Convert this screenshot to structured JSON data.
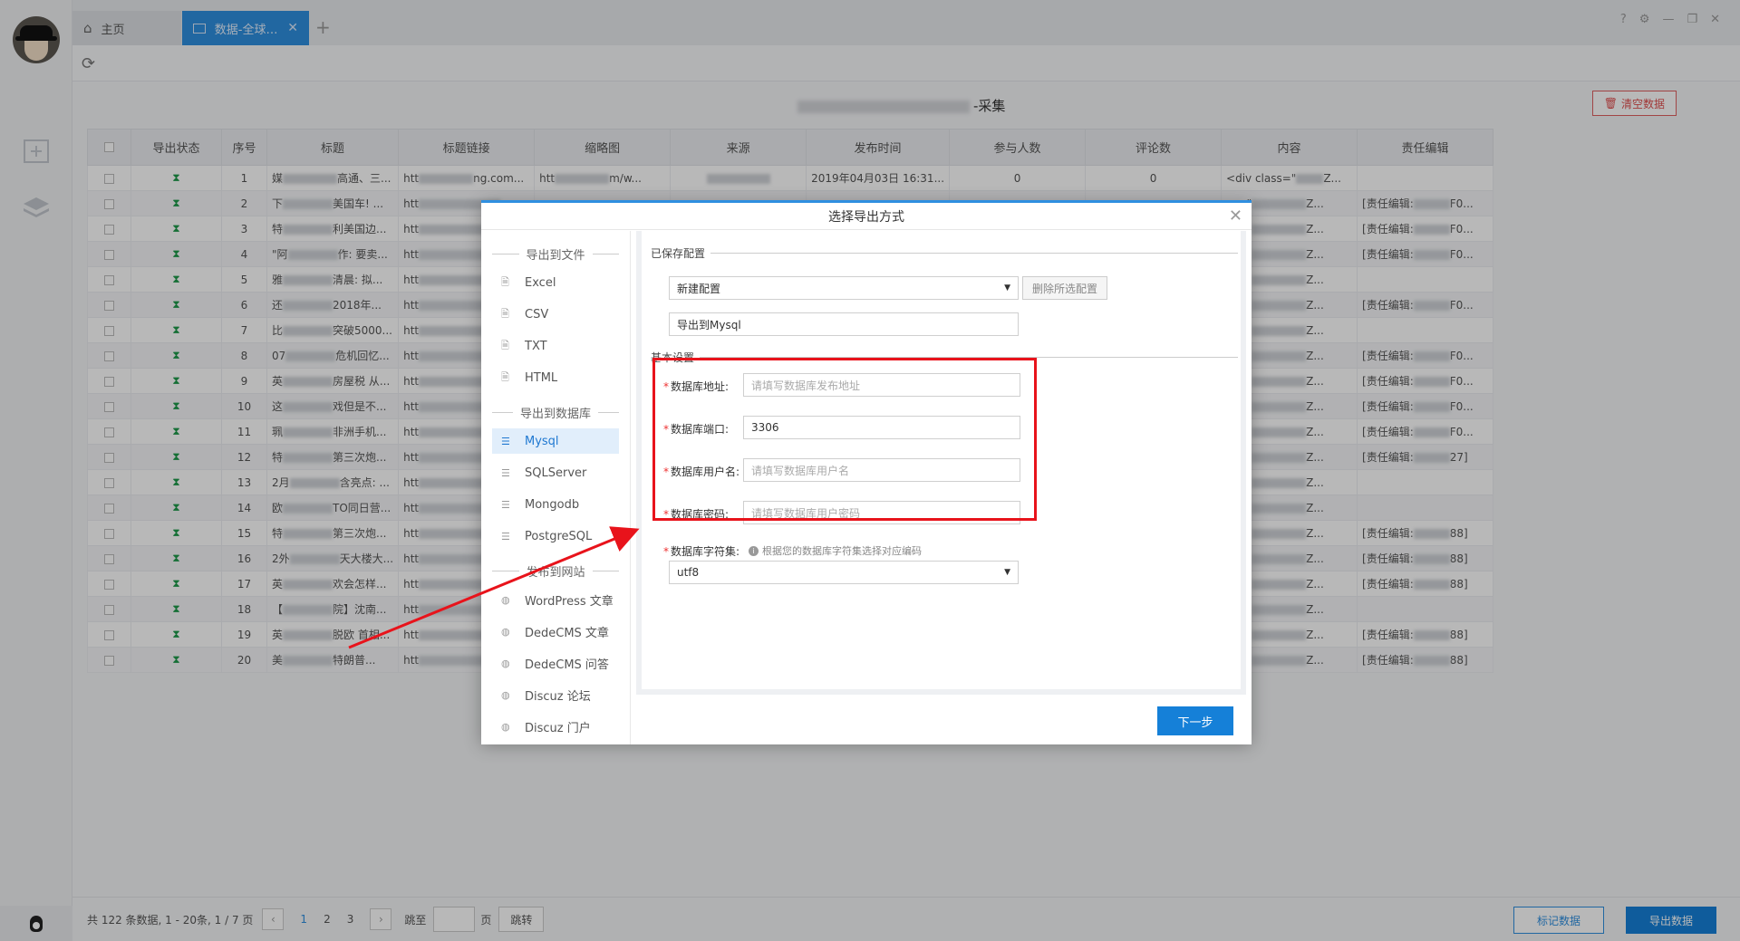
{
  "tabs": {
    "home": "主页",
    "active": "数据-全球财..."
  },
  "page": {
    "title_suffix": "-采集",
    "clear_button": "清空数据"
  },
  "table": {
    "headers": [
      "",
      "导出状态",
      "序号",
      "标题",
      "标题链接",
      "缩略图",
      "来源",
      "发布时间",
      "参与人数",
      "评论数",
      "内容",
      "责任编辑"
    ],
    "row1": {
      "title": "媒",
      "title2": "高通、三...",
      "link": "htt",
      "link2": "ng.com...",
      "thumb": "htt",
      "thumb2": "m/w...",
      "source": "",
      "time": "2019年04月03日 16:31...",
      "participants": "0",
      "comments": "0",
      "content": "<div class=\"",
      "content2": "Z...",
      "editor": ""
    },
    "rows": [
      {
        "n": "2",
        "t": "下",
        "t2": "美国车! ...",
        "e": "[责任编辑:",
        "e2": "F0..."
      },
      {
        "n": "3",
        "t": "特",
        "t2": "利美国边...",
        "e": "[责任编辑:",
        "e2": "F0..."
      },
      {
        "n": "4",
        "t": "\"阿",
        "t2": "作: 要卖...",
        "e": "[责任编辑:",
        "e2": "F0..."
      },
      {
        "n": "5",
        "t": "雅",
        "t2": "清晨: 拟...",
        "e": "",
        "e2": ""
      },
      {
        "n": "6",
        "t": "还",
        "t2": "2018年...",
        "e": "[责任编辑:",
        "e2": "F0..."
      },
      {
        "n": "7",
        "t": "比",
        "t2": "突破5000...",
        "e": "",
        "e2": ""
      },
      {
        "n": "8",
        "t": "07",
        "t2": "危机回忆...",
        "e": "[责任编辑:",
        "e2": "F0..."
      },
      {
        "n": "9",
        "t": "英",
        "t2": "房屋税 从...",
        "e": "[责任编辑:",
        "e2": "F0..."
      },
      {
        "n": "10",
        "t": "这",
        "t2": "戏但是不...",
        "e": "[责任编辑:",
        "e2": "F0..."
      },
      {
        "n": "11",
        "t": "珮",
        "t2": "非洲手机...",
        "e": "[责任编辑:",
        "e2": "F0..."
      },
      {
        "n": "12",
        "t": "特",
        "t2": "第三次炮...",
        "e": "[责任编辑:",
        "e2": "27]"
      },
      {
        "n": "13",
        "t": "2月",
        "t2": "含亮点: ...",
        "e": "",
        "e2": ""
      },
      {
        "n": "14",
        "t": "欧",
        "t2": "TO同日营...",
        "e": "",
        "e2": ""
      },
      {
        "n": "15",
        "t": "特",
        "t2": "第三次炮...",
        "e": "[责任编辑:",
        "e2": "88]"
      },
      {
        "n": "16",
        "t": "2外",
        "t2": "天大楼大...",
        "e": "[责任编辑:",
        "e2": "88]"
      },
      {
        "n": "17",
        "t": "英",
        "t2": "欢会怎样...",
        "e": "[责任编辑:",
        "e2": "88]"
      },
      {
        "n": "18",
        "t": "【",
        "t2": "院】沈南...",
        "e": "",
        "e2": ""
      },
      {
        "n": "19",
        "t": "英",
        "t2": "脱欧 首相...",
        "e": "[责任编辑:",
        "e2": "88]"
      },
      {
        "n": "20",
        "t": "美",
        "t2": "特朗普...",
        "e": "[责任编辑:",
        "e2": "88]"
      }
    ],
    "link_prefix": "htt",
    "content_prefix": "ss=\"",
    "content_suffix": "Z..."
  },
  "pager": {
    "summary": "共 122 条数据, 1 - 20条, 1 / 7 页",
    "p1": "1",
    "p2": "2",
    "p3": "3",
    "goto": "跳至",
    "page_unit": "页",
    "go": "跳转",
    "mark": "标记数据",
    "export": "导出数据"
  },
  "modal": {
    "title": "选择导出方式",
    "group_file": "导出到文件",
    "group_db": "导出到数据库",
    "group_web": "发布到网站",
    "files": [
      "Excel",
      "CSV",
      "TXT",
      "HTML"
    ],
    "dbs": [
      "Mysql",
      "SQLServer",
      "Mongodb",
      "PostgreSQL"
    ],
    "webs": [
      "WordPress 文章",
      "DedeCMS 文章",
      "DedeCMS 问答",
      "Discuz 论坛",
      "Discuz 门户"
    ],
    "saved_section": "已保存配置",
    "saved_select": "新建配置",
    "delete_btn": "删除所选配置",
    "config_name": "导出到Mysql",
    "basic_section": "基本设置",
    "host_label": "数据库地址:",
    "host_placeholder": "请填写数据库发布地址",
    "port_label": "数据库端口:",
    "port_value": "3306",
    "user_label": "数据库用户名:",
    "user_placeholder": "请填写数据库用户名",
    "pass_label": "数据库密码:",
    "pass_placeholder": "请填写数据库用户密码",
    "charset_label": "数据库字符集:",
    "charset_hint": "根据您的数据库字符集选择对应编码",
    "charset_value": "utf8",
    "next": "下一步"
  },
  "colors": {
    "accent": "#1580d8",
    "highlight": "#e8131b",
    "status": "#1e9a4a"
  }
}
